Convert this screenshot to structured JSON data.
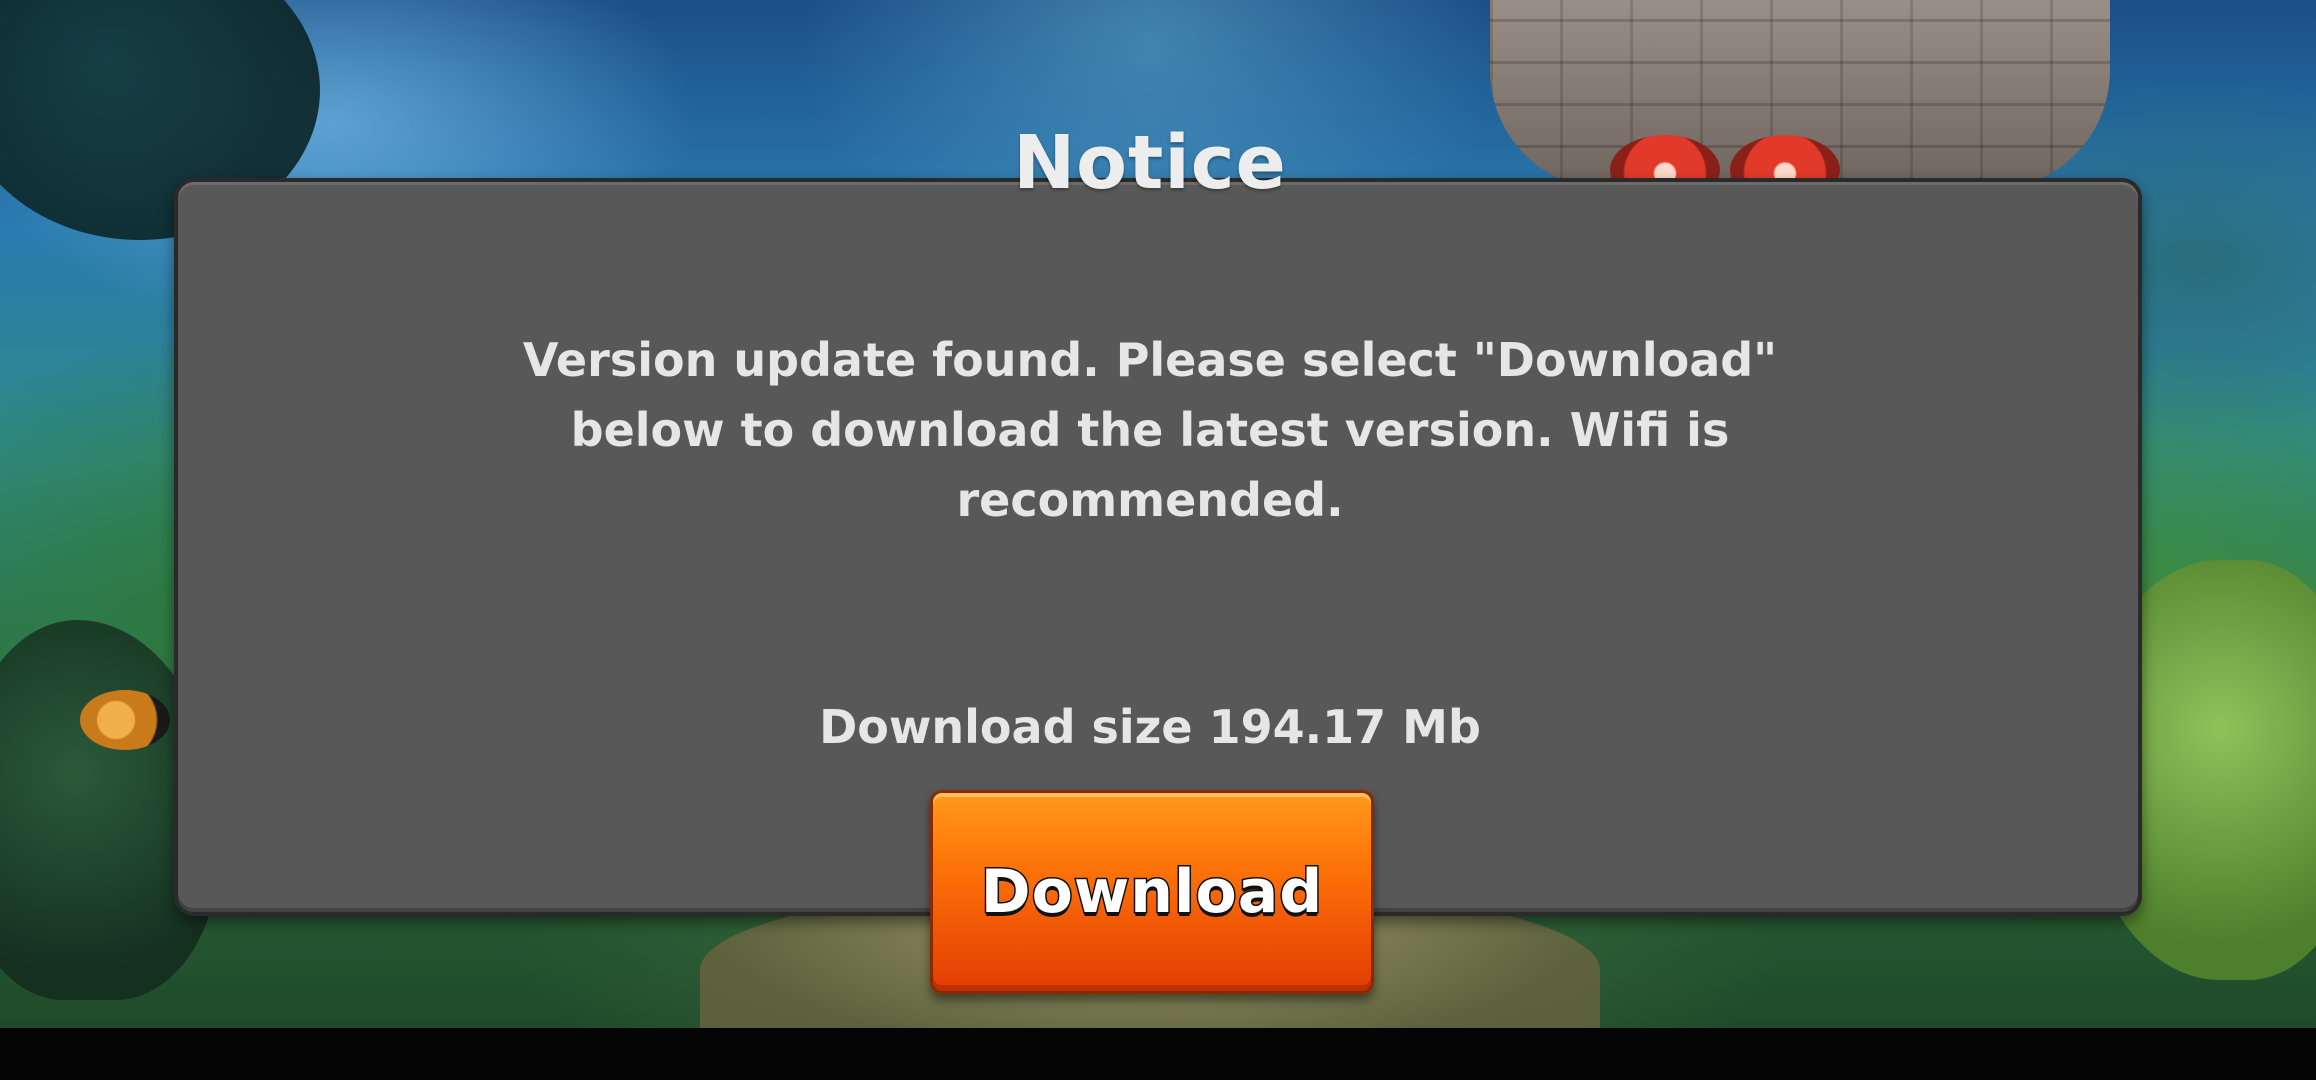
{
  "dialog": {
    "title": "Notice",
    "message": "Version update found. Please select \"Download\" below to download the latest version. Wifi is recommended.",
    "download_size_text": "Download size 194.17 Mb",
    "button_label": "Download"
  },
  "colors": {
    "dialog_background": "#585858",
    "dialog_text": "#e6e6e6",
    "button_orange": "#f25a06",
    "bottom_bar": "#050505"
  }
}
